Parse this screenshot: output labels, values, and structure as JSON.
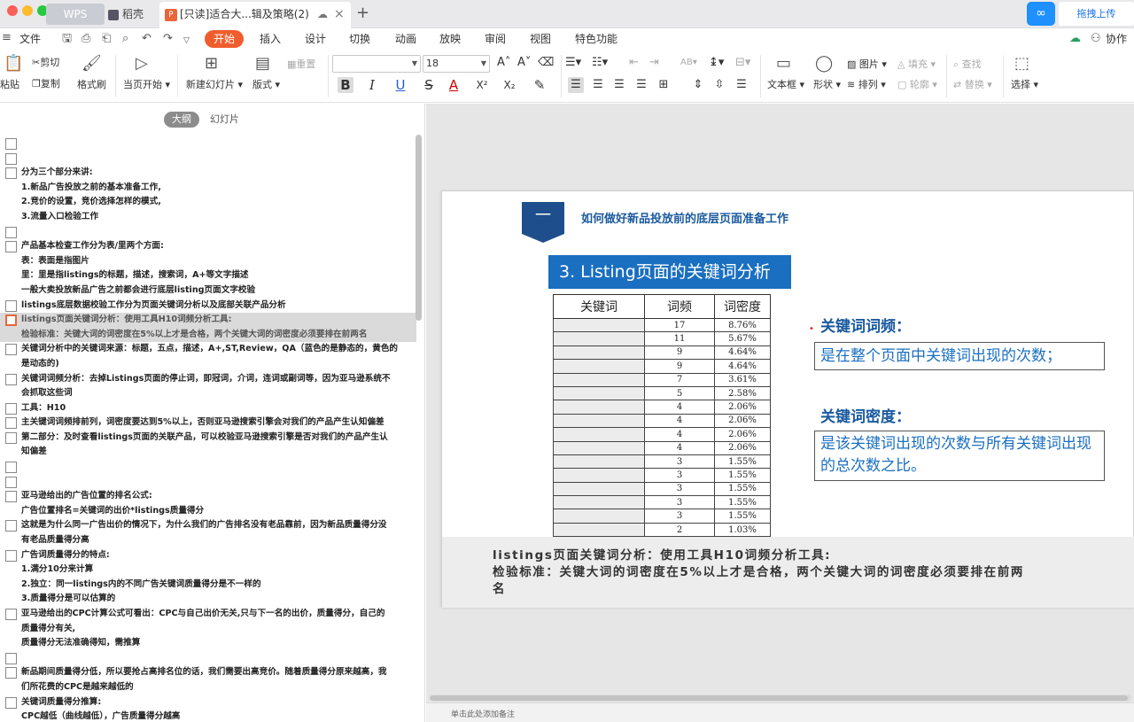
{
  "titlebar": {
    "tabs": [
      {
        "label": "WPS"
      },
      {
        "label": "稻壳"
      },
      {
        "label": "[只读]适合大...辑及策略(2)"
      }
    ],
    "doc_badge": "P",
    "add_tab": "+",
    "upload_label": "拖拽上传"
  },
  "menu": {
    "items": [
      "文件",
      "开始",
      "插入",
      "设计",
      "切换",
      "动画",
      "放映",
      "审阅",
      "视图",
      "特色功能"
    ],
    "collab": "协作"
  },
  "toolbar": {
    "paste": "粘贴",
    "cut": "剪切",
    "copy": "复制",
    "format_painter": "格式刷",
    "play_from_current": "当页开始",
    "new_slide": "新建幻灯片",
    "layout": "版式",
    "reset": "重置",
    "font_size": "18",
    "textbox": "文本框",
    "shape": "形状",
    "picture": "图片",
    "arrange": "排列",
    "fill": "填充",
    "outline": "轮廓",
    "find": "查找",
    "replace": "替换",
    "select": "选择"
  },
  "left_panel": {
    "tabs": [
      "大纲",
      "幻灯片"
    ],
    "outline": [
      {
        "text": "",
        "box": true
      },
      {
        "text": "",
        "box": true
      },
      {
        "text": "分为三个部分来讲:",
        "box": true
      },
      {
        "text": "1.新品广告投放之前的基本准备工作,",
        "box": false
      },
      {
        "text": "2.竞价的设置，竞价选择怎样的模式,",
        "box": false
      },
      {
        "text": "3.流量入口检验工作",
        "box": false
      },
      {
        "text": "",
        "box": true
      },
      {
        "text": "产品基本检查工作分为表/里两个方面:",
        "box": true
      },
      {
        "text": "表：表面是指图片",
        "box": false
      },
      {
        "text": "里：里是指listings的标题，描述，搜索词，A+等文字描述",
        "box": false
      },
      {
        "text": "一般大卖投放新品广告之前都会进行底层listing页面文字校验",
        "box": false
      },
      {
        "text": "listings底层数据校验工作分为页面关键词分析以及底部关联产品分析",
        "box": true
      },
      {
        "text": "listings页面关键词分析：使用工具H10词频分析工具:",
        "box": true,
        "highlight": true,
        "orange": true
      },
      {
        "text": "检验标准：关键大词的词密度在5%以上才是合格，两个关键大词的词密度必须要排在前两名",
        "box": false,
        "highlight": true
      },
      {
        "text": "关键词分析中的关键词来源：标题，五点，描述，A+,ST,Review，QA（蓝色的是静态的，黄色的",
        "box": true
      },
      {
        "text": "是动态的)",
        "box": false
      },
      {
        "text": "关键词词频分析：去掉Listings页面的停止词，即冠词，介词，连词或副词等，因为亚马逊系统不",
        "box": true
      },
      {
        "text": "会抓取这些词",
        "box": false
      },
      {
        "text": "工具：H10",
        "box": true
      },
      {
        "text": "主关键词词频排前列，词密度要达到5%以上，否则亚马逊搜索引擎会对我们的产品产生认知偏差",
        "box": true
      },
      {
        "text": "第二部分：及时查看listings页面的关联产品，可以校验亚马逊搜索引擎是否对我们的产品产生认",
        "box": true
      },
      {
        "text": "知偏差",
        "box": false
      },
      {
        "text": "",
        "box": true
      },
      {
        "text": "",
        "box": true
      },
      {
        "text": "亚马逊给出的广告位置的排名公式:",
        "box": true
      },
      {
        "text": "广告位置排名=关键词的出价*listings质量得分",
        "box": false
      },
      {
        "text": "这就是为什么同一广告出价的情况下，为什么我们的广告排名没有老品靠前，因为新品质量得分没",
        "box": true
      },
      {
        "text": "有老品质量得分高",
        "box": false
      },
      {
        "text": "广告词质量得分的特点:",
        "box": true
      },
      {
        "text": "1.满分10分来计算",
        "box": false
      },
      {
        "text": "2.独立：同一listings内的不同广告关键词质量得分是不一样的",
        "box": false
      },
      {
        "text": "3.质量得分是可以估算的",
        "box": false
      },
      {
        "text": "亚马逊给出的CPC计算公式可看出：CPC与自己出价无关,只与下一名的出价，质量得分，自己的",
        "box": true
      },
      {
        "text": "质量得分有关,",
        "box": false
      },
      {
        "text": "质量得分无法准确得知，需推算",
        "box": false
      },
      {
        "text": "",
        "box": true
      },
      {
        "text": "新品期间质量得分低，所以要抢占高排名位的话，我们需要出高竞价。随着质量得分原来越高，我",
        "box": true
      },
      {
        "text": "们所花费的CPC是越来越低的",
        "box": false
      },
      {
        "text": "关键词质量得分推算:",
        "box": true
      },
      {
        "text": "CPC越低（曲线越低），广告质量得分越高",
        "box": false
      }
    ]
  },
  "slide": {
    "badge": "一",
    "title": "如何做好新品投放前的底层页面准备工作",
    "section_head": "3. Listing页面的关键词分析",
    "table": {
      "headers": [
        "关键词",
        "词频",
        "词密度"
      ],
      "rows": [
        {
          "freq": "17",
          "density": "8.76%"
        },
        {
          "freq": "11",
          "density": "5.67%"
        },
        {
          "freq": "9",
          "density": "4.64%"
        },
        {
          "freq": "9",
          "density": "4.64%"
        },
        {
          "freq": "7",
          "density": "3.61%"
        },
        {
          "freq": "5",
          "density": "2.58%"
        },
        {
          "freq": "4",
          "density": "2.06%"
        },
        {
          "freq": "4",
          "density": "2.06%"
        },
        {
          "freq": "4",
          "density": "2.06%"
        },
        {
          "freq": "4",
          "density": "2.06%"
        },
        {
          "freq": "3",
          "density": "1.55%"
        },
        {
          "freq": "3",
          "density": "1.55%"
        },
        {
          "freq": "3",
          "density": "1.55%"
        },
        {
          "freq": "3",
          "density": "1.55%"
        },
        {
          "freq": "3",
          "density": "1.55%"
        },
        {
          "freq": "2",
          "density": "1.03%"
        }
      ]
    },
    "freq_label": "关键词词频：",
    "freq_desc": "是在整个页面中关键词出现的次数；",
    "density_label": "关键词密度：",
    "density_desc": "是该关键词出现的次数与所有关键词出现的总次数之比。",
    "caption": [
      "listings页面关键词分析：使用工具H10词频分析工具:",
      "检验标准：关键大词的词密度在5%以上才是合格，两个关键大词的词密度必须要排在前两",
      "名"
    ]
  },
  "notes_placeholder": "单击此处添加备注",
  "colors": {
    "accent": "#f05d2c",
    "slide_blue": "#1a6fc0",
    "brand_blue": "#1e90ff"
  }
}
